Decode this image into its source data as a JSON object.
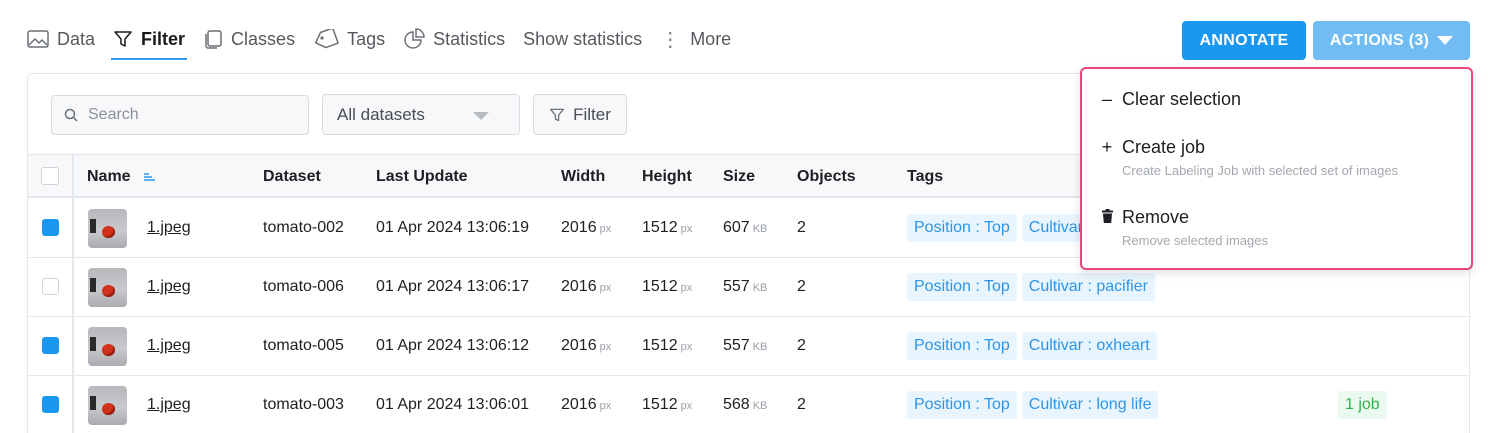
{
  "tabs": [
    {
      "label": "Data",
      "icon": "image-icon",
      "active": false
    },
    {
      "label": "Filter",
      "icon": "filter-icon",
      "active": true
    },
    {
      "label": "Classes",
      "icon": "classes-icon",
      "active": false
    },
    {
      "label": "Tags",
      "icon": "tag-icon",
      "active": false
    },
    {
      "label": "Statistics",
      "icon": "pie-chart-icon",
      "active": false
    },
    {
      "label": "Show statistics",
      "icon": "",
      "active": false
    },
    {
      "label": "More",
      "icon": "more-vertical-icon",
      "active": false
    }
  ],
  "toolbar": {
    "annotate_label": "ANNOTATE",
    "actions_label": "ACTIONS (3)"
  },
  "filters": {
    "search_placeholder": "Search",
    "dataset_select": "All datasets",
    "filter_label": "Filter"
  },
  "table": {
    "columns": [
      "Name",
      "Dataset",
      "Last Update",
      "Width",
      "Height",
      "Size",
      "Objects",
      "Tags"
    ],
    "rows": [
      {
        "checked": true,
        "name": "1.jpeg",
        "dataset": "tomato-002",
        "updated": "01 Apr 2024 13:06:19",
        "width": "2016",
        "width_unit": "px",
        "height": "1512",
        "height_unit": "px",
        "size": "607",
        "size_unit": "KB",
        "objects": "2",
        "tags": [
          "Position : Top",
          "Cultivar"
        ],
        "jobs": ""
      },
      {
        "checked": false,
        "name": "1.jpeg",
        "dataset": "tomato-006",
        "updated": "01 Apr 2024 13:06:17",
        "width": "2016",
        "width_unit": "px",
        "height": "1512",
        "height_unit": "px",
        "size": "557",
        "size_unit": "KB",
        "objects": "2",
        "tags": [
          "Position : Top",
          "Cultivar : pacifier"
        ],
        "jobs": ""
      },
      {
        "checked": true,
        "name": "1.jpeg",
        "dataset": "tomato-005",
        "updated": "01 Apr 2024 13:06:12",
        "width": "2016",
        "width_unit": "px",
        "height": "1512",
        "height_unit": "px",
        "size": "557",
        "size_unit": "KB",
        "objects": "2",
        "tags": [
          "Position : Top",
          "Cultivar : oxheart"
        ],
        "jobs": ""
      },
      {
        "checked": true,
        "name": "1.jpeg",
        "dataset": "tomato-003",
        "updated": "01 Apr 2024 13:06:01",
        "width": "2016",
        "width_unit": "px",
        "height": "1512",
        "height_unit": "px",
        "size": "568",
        "size_unit": "KB",
        "objects": "2",
        "tags": [
          "Position : Top",
          "Cultivar : long life"
        ],
        "jobs": "1 job"
      }
    ]
  },
  "dropdown": {
    "items": [
      {
        "label": "Clear selection",
        "icon": "minus-icon",
        "description": ""
      },
      {
        "label": "Create job",
        "icon": "plus-icon",
        "description": "Create Labeling Job with selected set of images"
      },
      {
        "label": "Remove",
        "icon": "trash-icon",
        "description": "Remove selected images"
      }
    ]
  },
  "colors": {
    "primary": "#1a97f0",
    "primary_light": "#72bcf4",
    "highlight_border": "#e7457e",
    "tag_bg": "#e8f4fe",
    "tag_text": "#2a96ea",
    "job_bg": "#eafaee",
    "job_text": "#2eb24e"
  }
}
